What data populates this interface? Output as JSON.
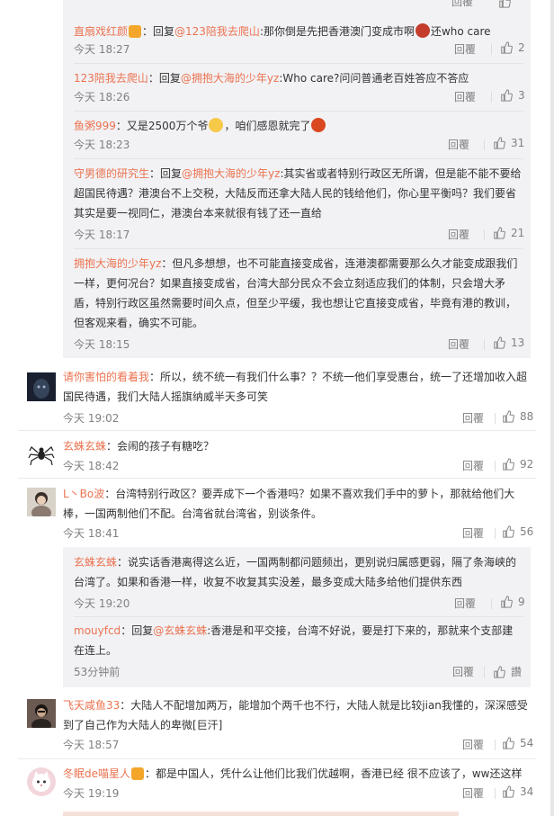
{
  "common": {
    "reply_label": "回覆"
  },
  "sub_comments": [
    {
      "name": "直扇戏红颜",
      "text": "：回复",
      "mention": "@123陪我去爬山",
      "text2": ":那你倒是先把香港澳门变成市啊",
      "text3": "还who care",
      "time": "今天 18:27",
      "likes": "2"
    },
    {
      "name": "123陪我去爬山",
      "text": "：回复",
      "mention": "@拥抱大海的少年yz",
      "text2": ":Who care?问问普通老百姓答应不答应",
      "text3": "",
      "time": "今天 18:26",
      "likes": "3"
    },
    {
      "name": "鱼粥999",
      "text": "：又是2500万个爷",
      "mention": "",
      "text2": "，咱们感恩就完了",
      "text3": "",
      "time": "今天 18:23",
      "likes": "31"
    },
    {
      "name": "守男德的研究生",
      "text": "：回复",
      "mention": "@拥抱大海的少年yz",
      "text2": ":其实省或者特别行政区无所谓，但是能不能不要给超国民待遇？港澳台不上交税，大陆反而还拿大陆人民的钱给他们，你心里平衡吗？我们要省其实是要一视同仁，港澳台本来就很有钱了还一直给",
      "text3": "",
      "time": "今天 18:17",
      "likes": "21"
    },
    {
      "name": "拥抱大海的少年yz",
      "text": "：但凡多想想，也不可能直接变成省，连港澳都需要那么久才能变成跟我们一样，更何况台？如果直接变成省，台湾大部分民众不会立刻适应我们的体制，只会增大矛盾，特别行政区虽然需要时间久点，但至少平缓，我也想让它直接变成省，毕竟有港的教训，但客观来看，确实不可能。",
      "mention": "",
      "text2": "",
      "text3": "",
      "time": "今天 18:15",
      "likes": "13"
    }
  ],
  "comments": [
    {
      "name": "请你害怕的看着我",
      "text": "：所以，统不统一有我们什么事？？不统一他们享受惠台，统一了还增加收入超国民待遇，我们大陆人摇旗纳威半天多可笑",
      "time": "今天 19:02",
      "likes": "88"
    },
    {
      "name": "玄蛛玄蛛",
      "text": "：会闹的孩子有糖吃？",
      "time": "今天 18:42",
      "likes": "92"
    },
    {
      "name": "L丶Bo波",
      "text": "：台湾特别行政区？要弄成下一个香港吗？如果不喜欢我们手中的萝卜，那就给他们大棒，一国两制他们不配。台湾省就台湾省，别谈条件。",
      "time": "今天 18:41",
      "likes": "56"
    },
    {
      "name": "飞天咸鱼33",
      "text": "：大陆人不配增加两万，能增加个两千也不行，大陆人就是比较jian我懂的，深深感受到了自己作为大陆人的卑微[巨汗]",
      "time": "今天 18:57",
      "likes": "54"
    },
    {
      "name": "冬眠de喵星人",
      "text": "：都是中国人，凭什么让他们比我们优越啊，香港已经 很不应该了，ww还这样",
      "time": "今天 19:19",
      "likes": "34"
    }
  ],
  "sub_comments_2": [
    {
      "name": "玄蛛玄蛛",
      "text": "：说实话香港离得这么近，一国两制都问题频出，更别说归属感更弱，隔了条海峡的台湾了。如果和香港一样，收复不收复其实没差，最多变成大陆多给他们提供东西",
      "mention": "",
      "text2": "",
      "time": "今天 19:20",
      "likes": "9"
    },
    {
      "name": "mouyfcd",
      "text": "：回复",
      "mention": "@玄蛛玄蛛",
      "text2": ":香港是和平交接，台湾不好说，要是打下来的，那就来个支部建在连上。",
      "time": "53分钟前",
      "likes": "讚"
    }
  ]
}
